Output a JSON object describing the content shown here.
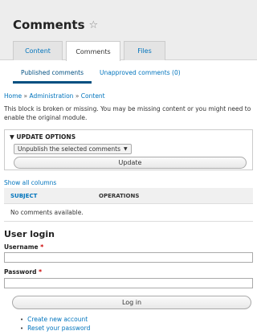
{
  "header": {
    "title": "Comments",
    "star_icon": "☆",
    "tabs": [
      {
        "label": "Content",
        "active": false
      },
      {
        "label": "Comments",
        "active": true
      },
      {
        "label": "Files",
        "active": false
      }
    ]
  },
  "subtabs": [
    {
      "label": "Published comments",
      "active": true
    },
    {
      "label": "Unapproved comments (0)",
      "active": false
    }
  ],
  "breadcrumb": {
    "items": [
      "Home",
      "Administration",
      "Content"
    ],
    "separator": "»"
  },
  "notice": "This block is broken or missing. You may be missing content or you might need to enable the original module.",
  "update_options": {
    "legend": "▼ UPDATE OPTIONS",
    "select_value": "Unpublish the selected comments",
    "caret": "▼",
    "update_label": "Update"
  },
  "table": {
    "show_columns": "Show all columns",
    "columns": [
      "SUBJECT",
      "OPERATIONS"
    ],
    "empty_text": "No comments available."
  },
  "login": {
    "title": "User login",
    "username_label": "Username",
    "password_label": "Password",
    "required_marker": "*",
    "login_label": "Log in",
    "links": [
      "Create new account",
      "Reset your password"
    ],
    "bullet": "•"
  },
  "colors": {
    "link": "#0074bd",
    "required": "#cc0000"
  }
}
